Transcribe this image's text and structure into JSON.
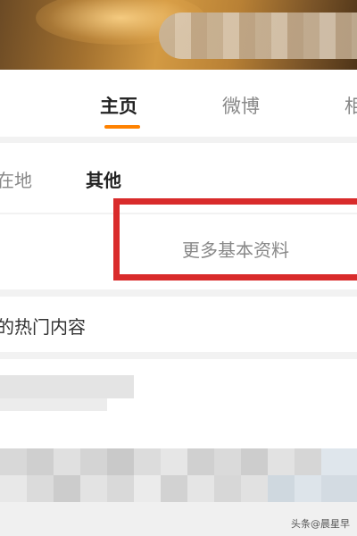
{
  "tabs": [
    {
      "label": "主页"
    },
    {
      "label": "微博"
    },
    {
      "label": "相"
    }
  ],
  "subtabs": [
    {
      "label": "在地"
    },
    {
      "label": "其他"
    }
  ],
  "more_info": {
    "label": "更多基本资料"
  },
  "hot_content": {
    "label": "的热门内容"
  },
  "watermark": "头条@晨星早",
  "colors": {
    "accent": "#ff8200",
    "highlight_box": "#d92b2b"
  }
}
